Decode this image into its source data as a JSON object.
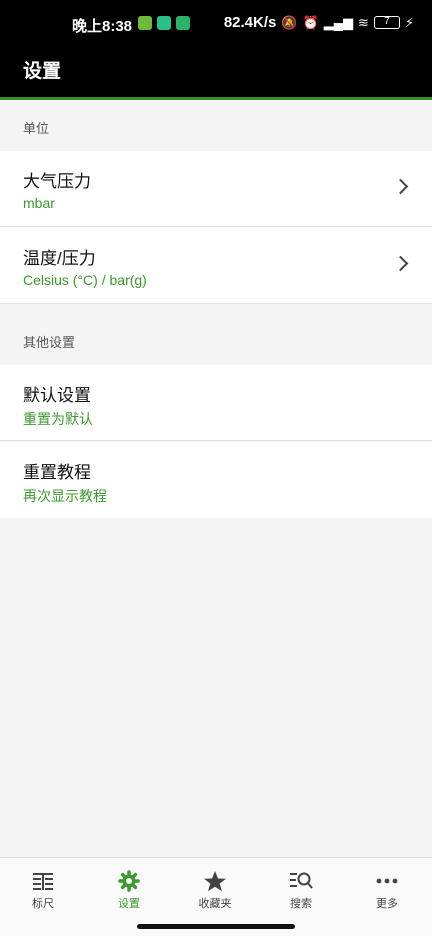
{
  "status_bar": {
    "time": "晚上8:38",
    "net_speed": "82.4K/s",
    "battery": "7",
    "colors": {
      "notif1": "#6dbb3a",
      "notif2": "#2bbf8a",
      "notif3": "#2bb36a"
    }
  },
  "appbar": {
    "title": "设置"
  },
  "sections": [
    {
      "header": "单位",
      "items": [
        {
          "title": "大气压力",
          "subtitle": "mbar"
        },
        {
          "title": "温度/压力",
          "subtitle": "Celsius (°C) / bar(g)"
        }
      ]
    },
    {
      "header": "其他设置",
      "items": [
        {
          "title": "默认设置",
          "subtitle": "重置为默认"
        },
        {
          "title": "重置教程",
          "subtitle": "再次显示教程"
        }
      ]
    }
  ],
  "bottom_nav": [
    {
      "label": "标尺",
      "icon": "ruler-icon",
      "active": false
    },
    {
      "label": "设置",
      "icon": "gear-icon",
      "active": true
    },
    {
      "label": "收藏夹",
      "icon": "star-icon",
      "active": false
    },
    {
      "label": "搜索",
      "icon": "search-icon",
      "active": false
    },
    {
      "label": "更多",
      "icon": "more-icon",
      "active": false
    }
  ],
  "accent_color": "#3a9a2c"
}
